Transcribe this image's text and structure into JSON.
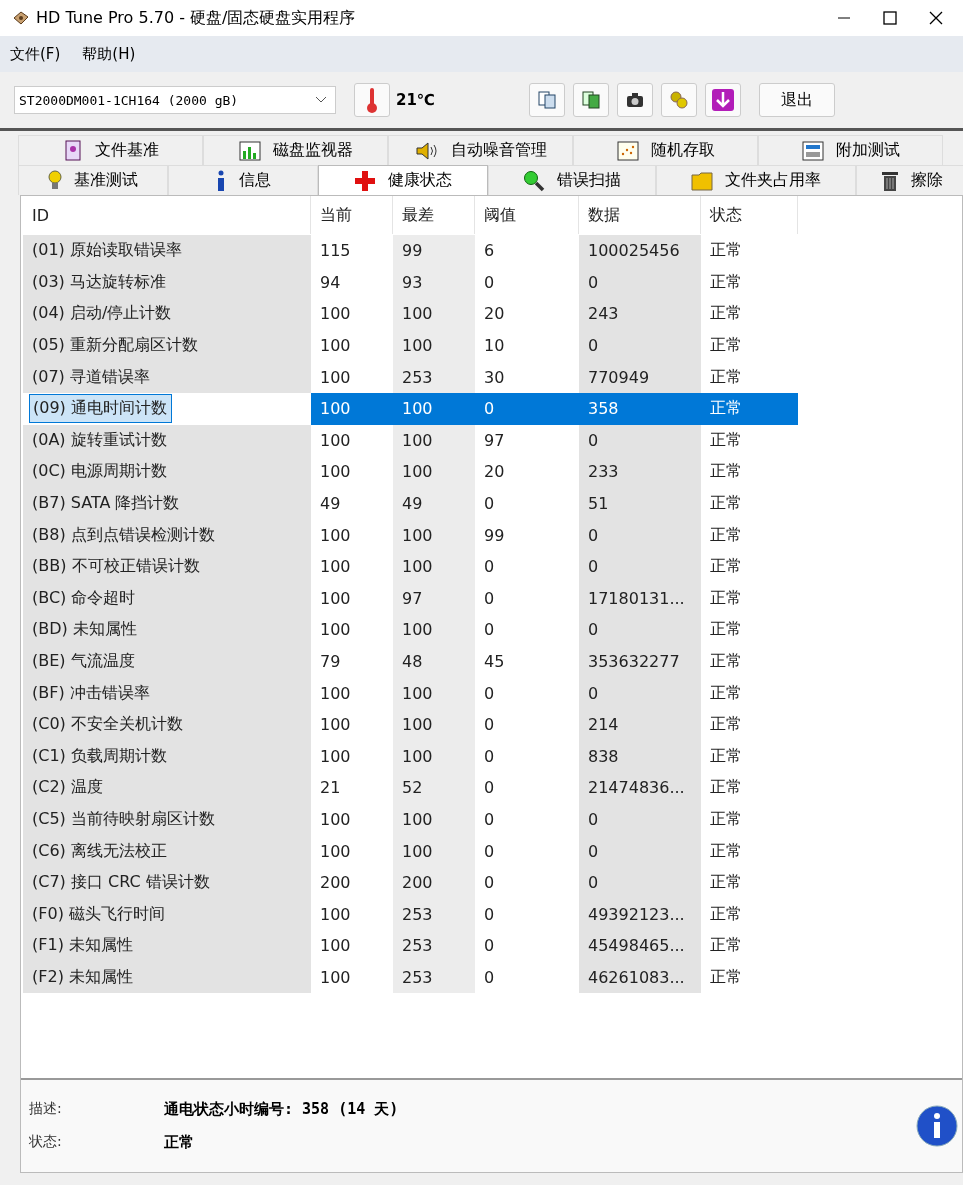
{
  "window": {
    "title": "HD Tune Pro 5.70 - 硬盘/固态硬盘实用程序"
  },
  "menu": [
    "文件(F)",
    "帮助(H)"
  ],
  "toolbar": {
    "drive": "ST2000DM001-1CH164 (2000 gB)",
    "temperature": "21℃",
    "exit_button": "退出"
  },
  "tab_rows": [
    [
      {
        "label": "文件基准",
        "kind": "page",
        "selected": false
      },
      {
        "label": "磁盘监视器",
        "kind": "chart",
        "selected": false
      },
      {
        "label": "自动噪音管理",
        "kind": "speaker",
        "selected": false
      },
      {
        "label": "随机存取",
        "kind": "dots",
        "selected": false
      },
      {
        "label": "附加测试",
        "kind": "calc",
        "selected": false
      }
    ],
    [
      {
        "label": "基准测试",
        "kind": "bulb",
        "selected": false
      },
      {
        "label": "信息",
        "kind": "info",
        "selected": false
      },
      {
        "label": "健康状态",
        "kind": "cross",
        "selected": true
      },
      {
        "label": "错误扫描",
        "kind": "magnifier",
        "selected": false
      },
      {
        "label": "文件夹占用率",
        "kind": "folder",
        "selected": false
      },
      {
        "label": "擦除",
        "kind": "trash",
        "selected": false
      }
    ]
  ],
  "table": {
    "columns": [
      "ID",
      "当前",
      "最差",
      "阈值",
      "数据",
      "状态"
    ],
    "rows": [
      {
        "cells": [
          "(01) 原始读取错误率",
          "115",
          "99",
          "6",
          "100025456",
          "正常"
        ],
        "selected": false
      },
      {
        "cells": [
          "(03) 马达旋转标准",
          "94",
          "93",
          "0",
          "0",
          "正常"
        ],
        "selected": false
      },
      {
        "cells": [
          "(04) 启动/停止计数",
          "100",
          "100",
          "20",
          "243",
          "正常"
        ],
        "selected": false
      },
      {
        "cells": [
          "(05) 重新分配扇区计数",
          "100",
          "100",
          "10",
          "0",
          "正常"
        ],
        "selected": false
      },
      {
        "cells": [
          "(07) 寻道错误率",
          "100",
          "253",
          "30",
          "770949",
          "正常"
        ],
        "selected": false
      },
      {
        "cells": [
          "(09) 通电时间计数",
          "100",
          "100",
          "0",
          "358",
          "正常"
        ],
        "selected": true
      },
      {
        "cells": [
          "(0A) 旋转重试计数",
          "100",
          "100",
          "97",
          "0",
          "正常"
        ],
        "selected": false
      },
      {
        "cells": [
          "(0C) 电源周期计数",
          "100",
          "100",
          "20",
          "233",
          "正常"
        ],
        "selected": false
      },
      {
        "cells": [
          "(B7) SATA 降挡计数",
          "49",
          "49",
          "0",
          "51",
          "正常"
        ],
        "selected": false
      },
      {
        "cells": [
          "(B8) 点到点错误检测计数",
          "100",
          "100",
          "99",
          "0",
          "正常"
        ],
        "selected": false
      },
      {
        "cells": [
          "(BB) 不可校正错误计数",
          "100",
          "100",
          "0",
          "0",
          "正常"
        ],
        "selected": false
      },
      {
        "cells": [
          "(BC) 命令超时",
          "100",
          "97",
          "0",
          "17180131...",
          "正常"
        ],
        "selected": false
      },
      {
        "cells": [
          "(BD) 未知属性",
          "100",
          "100",
          "0",
          "0",
          "正常"
        ],
        "selected": false
      },
      {
        "cells": [
          "(BE) 气流温度",
          "79",
          "48",
          "45",
          "353632277",
          "正常"
        ],
        "selected": false
      },
      {
        "cells": [
          "(BF) 冲击错误率",
          "100",
          "100",
          "0",
          "0",
          "正常"
        ],
        "selected": false
      },
      {
        "cells": [
          "(C0) 不安全关机计数",
          "100",
          "100",
          "0",
          "214",
          "正常"
        ],
        "selected": false
      },
      {
        "cells": [
          "(C1) 负载周期计数",
          "100",
          "100",
          "0",
          "838",
          "正常"
        ],
        "selected": false
      },
      {
        "cells": [
          "(C2) 温度",
          "21",
          "52",
          "0",
          "21474836...",
          "正常"
        ],
        "selected": false
      },
      {
        "cells": [
          "(C5) 当前待映射扇区计数",
          "100",
          "100",
          "0",
          "0",
          "正常"
        ],
        "selected": false
      },
      {
        "cells": [
          "(C6) 离线无法校正",
          "100",
          "100",
          "0",
          "0",
          "正常"
        ],
        "selected": false
      },
      {
        "cells": [
          "(C7) 接口 CRC 错误计数",
          "200",
          "200",
          "0",
          "0",
          "正常"
        ],
        "selected": false
      },
      {
        "cells": [
          "(F0) 磁头飞行时间",
          "100",
          "253",
          "0",
          "49392123...",
          "正常"
        ],
        "selected": false
      },
      {
        "cells": [
          "(F1) 未知属性",
          "100",
          "253",
          "0",
          "45498465...",
          "正常"
        ],
        "selected": false
      },
      {
        "cells": [
          "(F2) 未知属性",
          "100",
          "253",
          "0",
          "46261083...",
          "正常"
        ],
        "selected": false
      }
    ]
  },
  "details": [
    {
      "label": "描述:",
      "value": "通电状态小时编号: 358 (14 天)"
    },
    {
      "label": "状态:",
      "value": "正常"
    }
  ]
}
